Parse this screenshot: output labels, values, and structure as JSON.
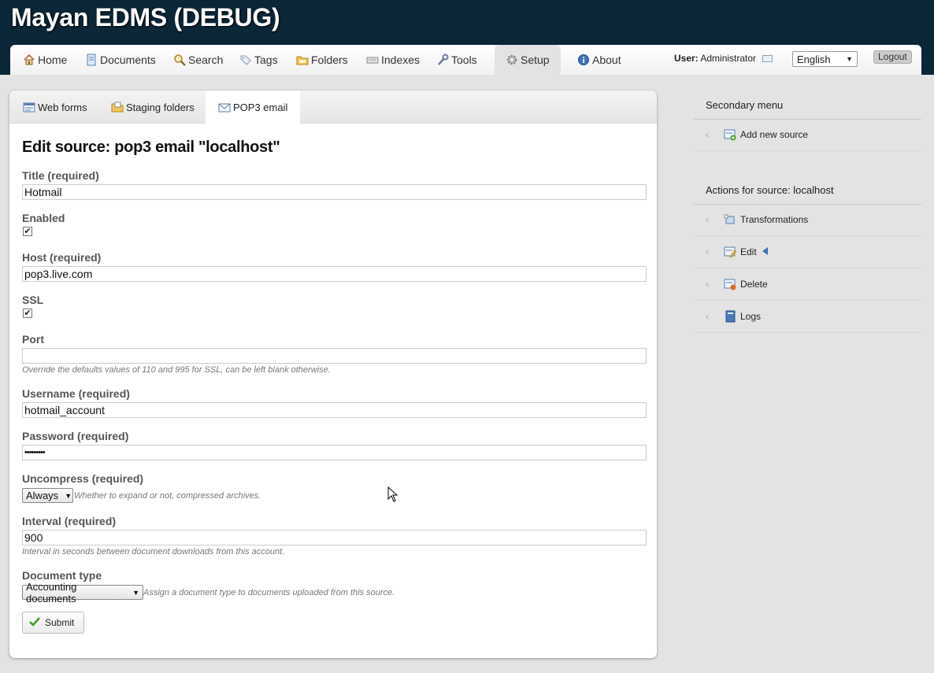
{
  "app": {
    "title": "Mayan EDMS (DEBUG)"
  },
  "nav": {
    "items": [
      {
        "label": "Home",
        "icon": "house-icon"
      },
      {
        "label": "Documents",
        "icon": "document-icon"
      },
      {
        "label": "Search",
        "icon": "magnifier-icon"
      },
      {
        "label": "Tags",
        "icon": "tag-icon"
      },
      {
        "label": "Folders",
        "icon": "folder-icon"
      },
      {
        "label": "Indexes",
        "icon": "keyboard-icon"
      },
      {
        "label": "Tools",
        "icon": "wrench-icon"
      },
      {
        "label": "Setup",
        "icon": "gear-icon"
      },
      {
        "label": "About",
        "icon": "info-icon"
      }
    ],
    "active": "Setup",
    "user_label": "User:",
    "user_name": "Administrator",
    "language": "English",
    "logout": "Logout"
  },
  "tabs": [
    {
      "label": "Web forms"
    },
    {
      "label": "Staging folders"
    },
    {
      "label": "POP3 email"
    }
  ],
  "active_tab": "POP3 email",
  "form": {
    "title": "Edit source: pop3 email \"localhost\"",
    "title_label": "Title (required)",
    "title_value": "Hotmail",
    "enabled_label": "Enabled",
    "enabled_checked": "✔",
    "host_label": "Host (required)",
    "host_value": "pop3.live.com",
    "ssl_label": "SSL",
    "ssl_checked": "✔",
    "port_label": "Port",
    "port_value": "",
    "port_help": "Override the defaults values of 110 and 995 for SSL, can be left blank otherwise.",
    "username_label": "Username (required)",
    "username_value": "hotmail_account",
    "password_label": "Password (required)",
    "password_value": "•••••••••",
    "uncompress_label": "Uncompress (required)",
    "uncompress_value": "Always",
    "uncompress_help": "Whether to expand or not, compressed archives.",
    "interval_label": "Interval (required)",
    "interval_value": "900",
    "interval_help": "Interval in seconds between document downloads from this account.",
    "doctype_label": "Document type",
    "doctype_value": "Accounting documents",
    "doctype_help": "Assign a document type to documents uploaded from this source.",
    "submit_label": "Submit"
  },
  "sidebar": {
    "secondary_heading": "Secondary menu",
    "secondary_items": [
      {
        "label": "Add new source",
        "icon": "add-source-icon"
      }
    ],
    "actions_heading": "Actions for source: localhost",
    "action_items": [
      {
        "label": "Transformations",
        "icon": "transform-icon"
      },
      {
        "label": "Edit",
        "icon": "edit-icon"
      },
      {
        "label": "Delete",
        "icon": "delete-icon"
      },
      {
        "label": "Logs",
        "icon": "logs-icon"
      }
    ]
  },
  "colors": {
    "header_bg": "#0b2637",
    "page_bg": "#e3e3e3",
    "panel_bg": "#ffffff",
    "submit_check": "#4aa02c"
  }
}
